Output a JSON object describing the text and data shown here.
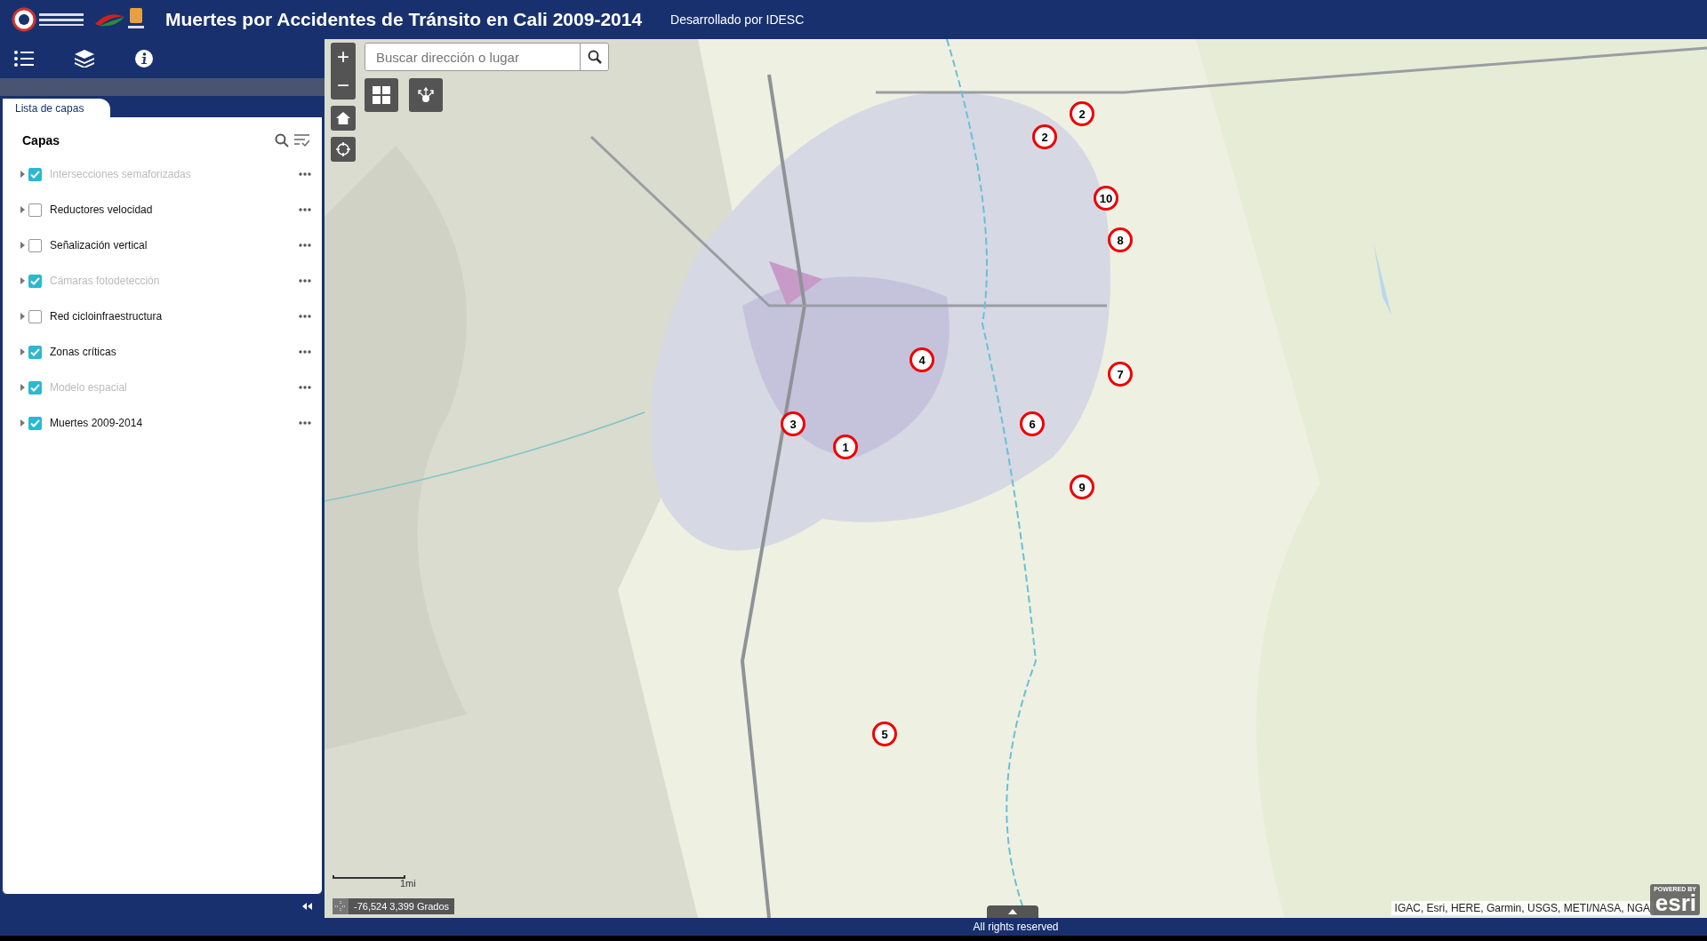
{
  "header": {
    "title": "Muertes por Accidentes de Tránsito en Cali 2009-2014",
    "subtitle": "Desarrollado por IDESC"
  },
  "panel": {
    "tab": "Lista de capas",
    "heading": "Capas",
    "layers": [
      {
        "label": "Intersecciones semaforizadas",
        "checked": true,
        "disabled": true
      },
      {
        "label": "Reductores velocidad",
        "checked": false,
        "disabled": false
      },
      {
        "label": "Señalización vertical",
        "checked": false,
        "disabled": false
      },
      {
        "label": "Cámaras fotodetección",
        "checked": true,
        "disabled": true
      },
      {
        "label": "Red cicloinfraestructura",
        "checked": false,
        "disabled": false
      },
      {
        "label": "Zonas críticas",
        "checked": true,
        "disabled": false
      },
      {
        "label": "Modelo espacial",
        "checked": true,
        "disabled": true
      },
      {
        "label": "Muertes 2009-2014",
        "checked": true,
        "disabled": false
      }
    ]
  },
  "map": {
    "search": {
      "placeholder": "Buscar dirección o lugar"
    },
    "zoom_in": "+",
    "zoom_out": "−",
    "markers": [
      {
        "label": "1"
      },
      {
        "label": "2"
      },
      {
        "label": "2"
      },
      {
        "label": "3"
      },
      {
        "label": "4"
      },
      {
        "label": "5"
      },
      {
        "label": "6"
      },
      {
        "label": "7"
      },
      {
        "label": "8"
      },
      {
        "label": "9"
      },
      {
        "label": "10"
      }
    ],
    "scale": "1mi",
    "coordinates": "-76,524 3,399 Grados",
    "attribution": "IGAC, Esri, HERE, Garmin, USGS, METI/NASA, NGA",
    "powered_by": "POWERED BY",
    "esri": "esri"
  },
  "footer": "All rights reserved"
}
